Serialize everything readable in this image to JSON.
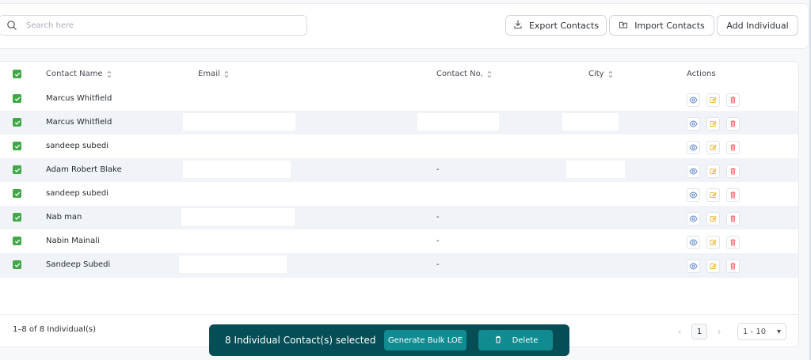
{
  "search": {
    "placeholder": "Search here"
  },
  "toolbar": {
    "export_label": "Export Contacts",
    "import_label": "Import Contacts",
    "add_label": "Add Individual"
  },
  "table": {
    "headers": [
      "Contact Name",
      "Email",
      "Contact No.",
      "City",
      "Actions"
    ],
    "rows": [
      {
        "name": "Marcus Whitfield",
        "email": "",
        "contact": "",
        "city": ""
      },
      {
        "name": "Marcus Whitfield",
        "email": "",
        "contact": "",
        "city": ""
      },
      {
        "name": "sandeep subedi",
        "email": "",
        "contact": "",
        "city": ""
      },
      {
        "name": "Adam Robert Blake",
        "email": "",
        "contact": "-",
        "city": ""
      },
      {
        "name": "sandeep subedi",
        "email": "",
        "contact": "",
        "city": ""
      },
      {
        "name": "Nab man",
        "email": "",
        "contact": "-",
        "city": ""
      },
      {
        "name": "Nabin Mainali",
        "email": "",
        "contact": "-",
        "city": ""
      },
      {
        "name": "Sandeep Subedi",
        "email": "",
        "contact": "-",
        "city": ""
      }
    ]
  },
  "footer": {
    "count_label": "1–8 of 8 Individual(s)",
    "page": "1",
    "page_size": "1 - 10"
  },
  "bulk": {
    "selected_label": "8 Individual Contact(s) selected",
    "generate_label": "Generate Bulk LOE",
    "delete_label": "Delete"
  },
  "colors": {
    "accent": "#064e55",
    "button": "#0f8b91",
    "checkbox": "#41a847"
  }
}
